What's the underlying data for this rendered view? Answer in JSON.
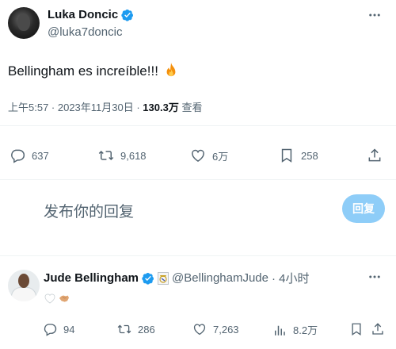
{
  "tweet": {
    "author_name": "Luka Doncic",
    "author_handle": "@luka7doncic",
    "text": "Bellingham es increíble!!!",
    "meta_time": "上午5:57 · 2023年11月30日 · ",
    "views_count": "130.3万",
    "views_label": " 查看",
    "actions": {
      "replies": "637",
      "retweets": "9,618",
      "likes": "6万",
      "bookmarks": "258"
    }
  },
  "reply_box": {
    "placeholder": "发布你的回复",
    "button_label": "回复"
  },
  "reply": {
    "author_name": "Jude Bellingham",
    "author_handle": "@BellinghamJude",
    "time": "· 4小时",
    "actions": {
      "replies": "94",
      "retweets": "286",
      "likes": "7,263",
      "views": "8.2万"
    }
  },
  "colors": {
    "accent": "#1d9bf0",
    "reply_button": "#8ecdf8",
    "secondary_text": "#536471",
    "fire": "#ff8a00"
  },
  "icons": [
    "verified-badge-icon",
    "fire-emoji",
    "more-icon",
    "reply-icon",
    "retweet-icon",
    "like-icon",
    "bookmark-icon",
    "share-icon",
    "views-icon",
    "club-crest-icon",
    "white-heart-emoji",
    "handshake-emoji"
  ]
}
